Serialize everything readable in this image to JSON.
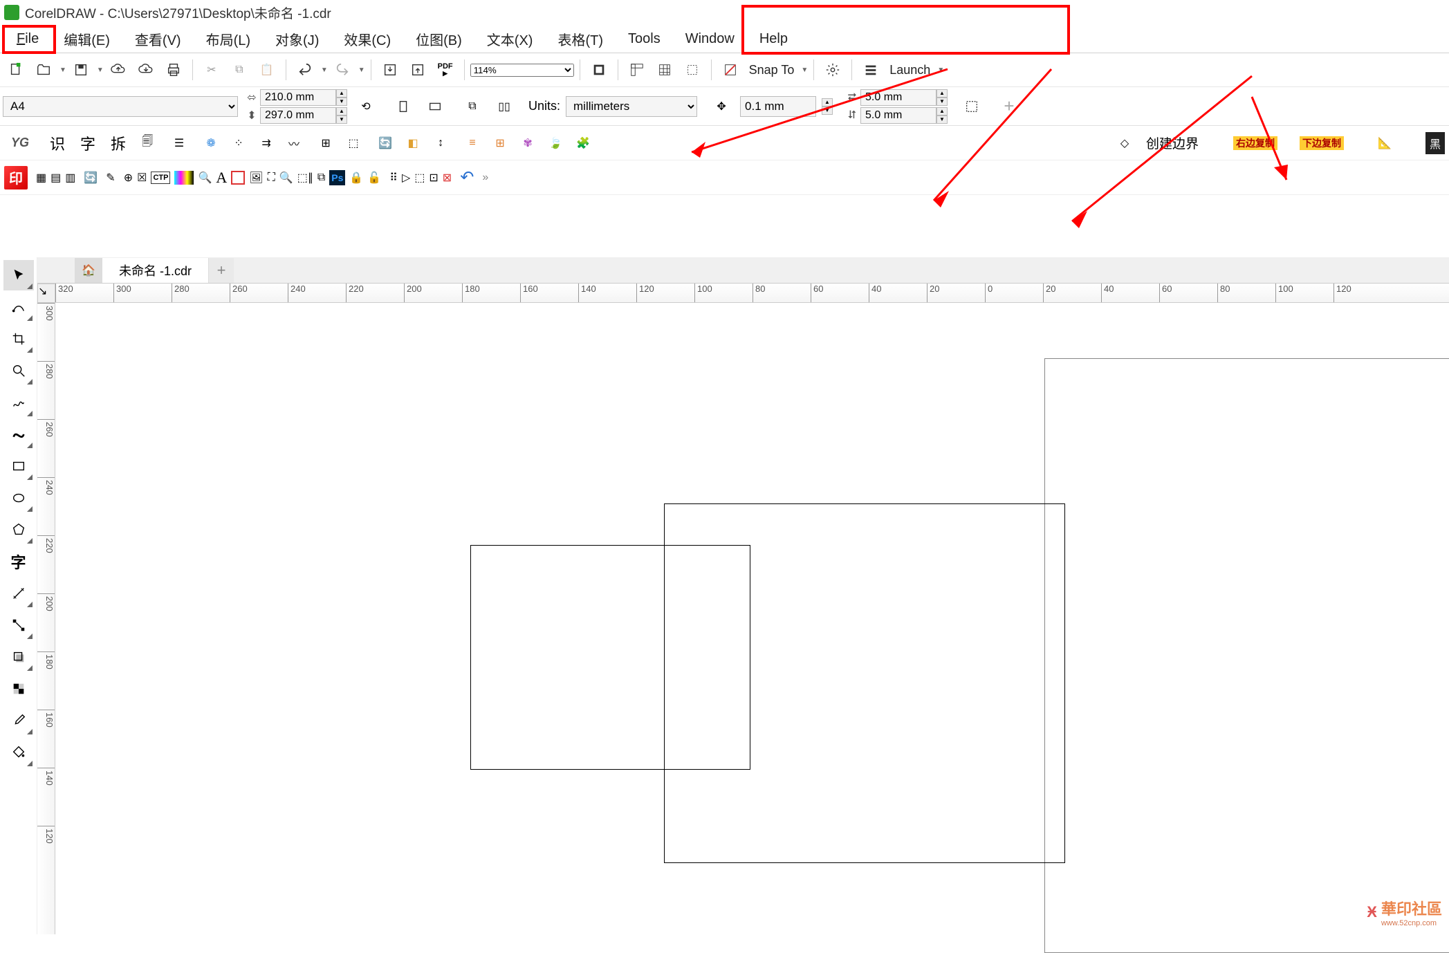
{
  "title": "CorelDRAW - C:\\Users\\27971\\Desktop\\未命名 -1.cdr",
  "menu": {
    "file": "File",
    "edit": "编辑(E)",
    "view": "查看(V)",
    "layout": "布局(L)",
    "object": "对象(J)",
    "effect": "效果(C)",
    "bitmap": "位图(B)",
    "text": "文本(X)",
    "table": "表格(T)",
    "tools": "Tools",
    "window": "Window",
    "help": "Help"
  },
  "toolbar1": {
    "zoom": "114%",
    "snap_to": "Snap To",
    "launch": "Launch"
  },
  "propbar": {
    "page_size": "A4",
    "width": "210.0 mm",
    "height": "297.0 mm",
    "units_label": "Units:",
    "units": "millimeters",
    "nudge": "0.1 mm",
    "dup_x": "5.0 mm",
    "dup_y": "5.0 mm"
  },
  "pluginrow": {
    "logo": "YG",
    "shi": "识",
    "zi": "字",
    "chai": "拆",
    "create_border": "创建边界",
    "badge_right": "右边复制",
    "badge_down": "下边复制",
    "black": "黑"
  },
  "tab": {
    "name": "未命名 -1.cdr"
  },
  "ruler_h": [
    "320",
    "300",
    "280",
    "260",
    "240",
    "220",
    "200",
    "180",
    "160",
    "140",
    "120",
    "100",
    "80",
    "60",
    "40",
    "20",
    "0",
    "20",
    "40",
    "60",
    "80",
    "100",
    "120"
  ],
  "ruler_v": [
    "300",
    "280",
    "260",
    "240",
    "220",
    "200",
    "180",
    "160",
    "140",
    "120"
  ],
  "watermark": {
    "main": "華印社區",
    "sub": "www.52cnp.com"
  }
}
